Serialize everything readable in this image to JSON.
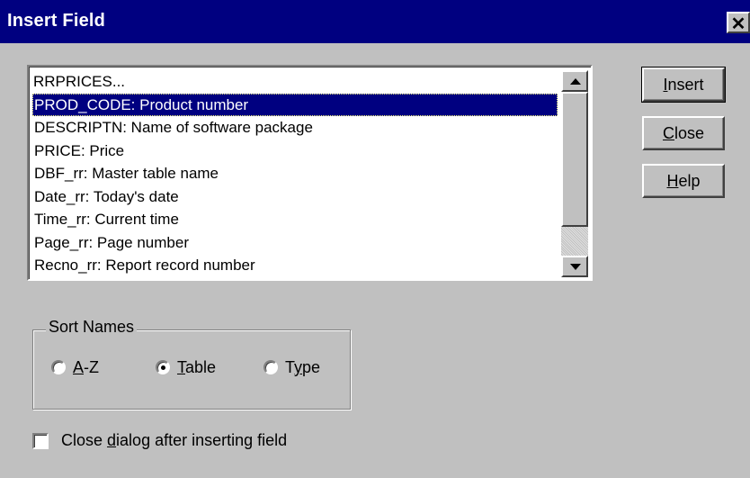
{
  "window": {
    "title": "Insert Field",
    "close_glyph": "✕"
  },
  "field_list": {
    "items": [
      "RRPRICES...",
      "PROD_CODE: Product number",
      "DESCRIPTN: Name of software package",
      "PRICE: Price",
      "DBF_rr: Master table name",
      "Date_rr: Today's date",
      "Time_rr: Current time",
      "Page_rr: Page number",
      "Recno_rr: Report record number"
    ],
    "selected_index": 1
  },
  "buttons": {
    "insert": {
      "mnemonic": "I",
      "rest": "nsert"
    },
    "close": {
      "mnemonic": "C",
      "rest": "lose"
    },
    "help": {
      "mnemonic": "H",
      "rest": "elp"
    }
  },
  "sort_names": {
    "title": "Sort Names",
    "options": [
      {
        "mnemonic": "A",
        "rest": "-Z",
        "selected": false
      },
      {
        "mnemonic": "T",
        "rest": "able",
        "selected": true
      },
      {
        "prefix": "T",
        "mnemonic": "y",
        "rest": "pe",
        "selected": false
      }
    ]
  },
  "close_after_insert": {
    "prefix": "Close ",
    "mnemonic": "d",
    "rest": "ialog after inserting field",
    "checked": false
  },
  "colors": {
    "titlebar": "#000080",
    "selection": "#000080",
    "face": "#c0c0c0"
  }
}
